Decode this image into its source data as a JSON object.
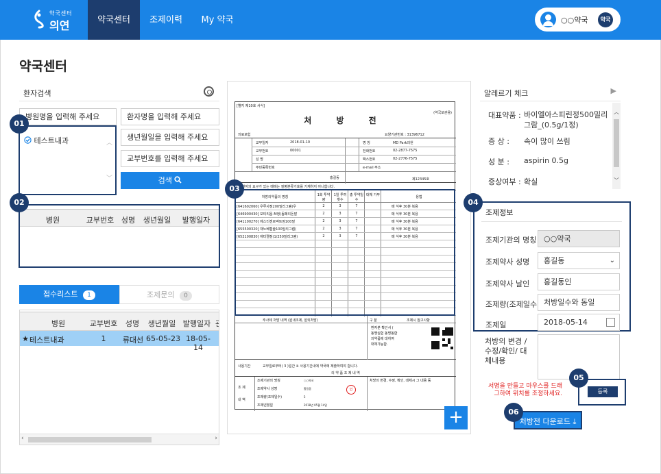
{
  "header": {
    "logo_sub": "약국센터",
    "logo_main": "의연",
    "nav": [
      "약국센터",
      "조제이력",
      "My 약국"
    ],
    "user_name": "○○약국",
    "user_role": "약국"
  },
  "page_title": "약국센터",
  "search": {
    "title": "환자검색",
    "hospital_placeholder": "병원명을 입력해 주세요",
    "patient_placeholder": "환자명을 입력해 주세요",
    "birth_placeholder": "생년월일을 입력해 주세요",
    "card_placeholder": "교부번호를 입력해 주세요",
    "hospital_item": "테스트내과",
    "search_button": "검색"
  },
  "steps": [
    "01",
    "02",
    "03",
    "04",
    "05",
    "06"
  ],
  "result_table": {
    "headers": [
      "병원",
      "교부번호",
      "성명",
      "생년월일",
      "발행일자"
    ]
  },
  "tabs": {
    "received_label": "접수리스트",
    "received_count": "1",
    "inquiry_label": "조제문의",
    "inquiry_count": "0"
  },
  "received_table": {
    "headers": [
      "병원",
      "교부번호",
      "성명",
      "생년월일",
      "발행일자",
      "관"
    ],
    "rows": [
      {
        "star": "★",
        "hospital": "테스트내과",
        "no": "1",
        "name": "류대선",
        "birth": "65-05-23",
        "date": "18-05-14"
      }
    ]
  },
  "prescription": {
    "form_label": "[별지 제10호 서식]",
    "form_right": "(약국보관용)",
    "title": "처 방 전",
    "insurance": "의료보험",
    "care_no_label": "요양기관번호 : 31396712",
    "rows_left": [
      {
        "label": "교부일자",
        "value": "2018-01-10"
      },
      {
        "label": "교부번호",
        "value": "00001"
      },
      {
        "label": "성 명",
        "value": ""
      },
      {
        "label": "주민등록번호",
        "value": ""
      }
    ],
    "rows_right": [
      {
        "label": "명 칭",
        "value": "MD Park의원"
      },
      {
        "label": "전화번호",
        "value": "02-2877-7575"
      },
      {
        "label": "팩스번호",
        "value": "02-2776-7575"
      },
      {
        "label": "e-mail 주소",
        "value": ""
      }
    ],
    "doctor_name": "홍길동",
    "license": "제12345호",
    "notice": "※ 환자의 요구가 있는 때에는 질병분류기호를 기재하지 아니합니다.",
    "drug_header": "처방의약품의 명칭",
    "drug_cols": [
      "1회 투약량",
      "1일 투여횟수",
      "총 투약일수",
      "대체 가부",
      "용법"
    ],
    "drugs": [
      {
        "name": "[641602060] 우루사정200밀리그램(우",
        "a": "2",
        "b": "3",
        "c": "7",
        "d": "",
        "use": "매 식후 30분 복용"
      },
      {
        "name": "[646900430] 모티리움-M정(돔페리돈말",
        "a": "2",
        "b": "3",
        "c": "7",
        "d": "",
        "use": "매 식후 30분 복용"
      },
      {
        "name": "[641100270] 에스티겐로엑트정100밀",
        "a": "2",
        "b": "3",
        "c": "7",
        "d": "",
        "use": "매 식후 30분 복용"
      },
      {
        "name": "[655500320] 재노베캡슐100밀리그램(",
        "a": "2",
        "b": "3",
        "c": "7",
        "d": "",
        "use": "매 식후 30분 복용"
      },
      {
        "name": "[652100830] 애타렐정(1/250밀리그램)",
        "a": "2",
        "b": "3",
        "c": "7",
        "d": "",
        "use": "매 식후 30분 복용"
      }
    ],
    "inject_label": "주사제 처방 내역 (원내조제, 원외처방)",
    "div_label": "구 분",
    "ref_label": "조제시 참고사항",
    "ref_text": [
      "환자분 확인서 (",
      "동맹실험 동명동합",
      "의약품에 대하여",
      "대체가능함."
    ],
    "use_period": "사용기간",
    "use_period_text": "교부일로부터( 3 )일간  ※ 사용기간내에 약국에 제출하여야 합니다.",
    "disp_title": "의 약 품 조 제 내 역",
    "disp_left": [
      "조 제",
      "내 역"
    ],
    "disp_rows": [
      "조제기관의 명칭",
      "조제약사 성명",
      "조제량(조제일수)",
      "조제년월일"
    ],
    "disp_values": [
      "○○약국",
      "홍길동",
      "5",
      "2018년 05월 14일"
    ],
    "disp_right": "처방의 변경, 수정, 확인, 대체시 그 내용 등",
    "stamp": "인"
  },
  "allergy": {
    "title": "알레르기 체크",
    "rows": [
      {
        "label": "대표약품 :",
        "value": "바이엘아스피린정500밀리그람_(0.5g/1정)"
      },
      {
        "label": "증 상 :",
        "value": "속이 많이 쓰림"
      },
      {
        "label": "성 분 :",
        "value": "aspirin 0.5g"
      },
      {
        "label": "증상여부 :",
        "value": "확실"
      }
    ]
  },
  "dispense": {
    "title": "조제정보",
    "rows": [
      {
        "label": "조제기관의 명칭",
        "value": "○○약국"
      },
      {
        "label": "조제약사 성명",
        "value": "홍길동"
      },
      {
        "label": "조제약사 날인",
        "value": "홍길동인"
      },
      {
        "label": "조제량(조제일수)",
        "value": "처방일수와 동일"
      },
      {
        "label": "조제일",
        "value": "2018-05-14"
      }
    ],
    "change_label": "처방의 변경 /수정/확인/ 대체내용",
    "hint": "서명을 만들고 마우스를 드래그하여 위치를 조정하세요.",
    "register_button": "등록",
    "download_button": "처방전 다운로드"
  },
  "colors": {
    "primary": "#1a84e6",
    "navy": "#1d3d6e",
    "row_selected": "#9fd0f6",
    "hint_red": "#e02020"
  }
}
